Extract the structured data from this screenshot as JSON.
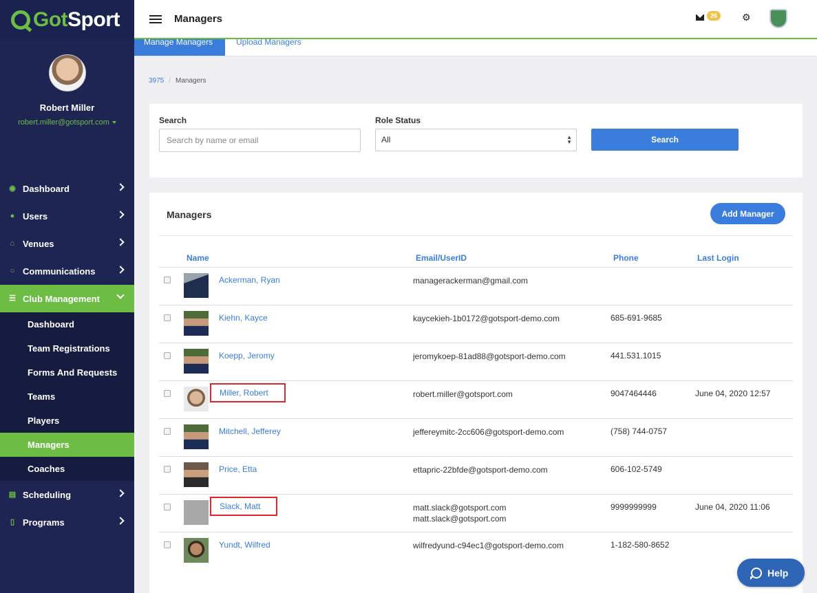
{
  "brand": {
    "logo_prefix": "Got",
    "logo_suffix": "Sport"
  },
  "profile": {
    "name": "Robert Miller",
    "email": "robert.miller@gotsport.com"
  },
  "sidebar": {
    "nav": [
      {
        "label": "Dashboard",
        "icon": "dashboard-icon"
      },
      {
        "label": "Users",
        "icon": "users-icon"
      },
      {
        "label": "Venues",
        "icon": "home-icon"
      },
      {
        "label": "Communications",
        "icon": "chat-icon"
      },
      {
        "label": "Club Management",
        "icon": "list-icon",
        "active": true
      }
    ],
    "sub": [
      "Dashboard",
      "Team Registrations",
      "Forms And Requests",
      "Teams",
      "Players",
      "Managers",
      "Coaches"
    ],
    "active_sub": "Managers",
    "nav_after": [
      {
        "label": "Scheduling",
        "icon": "calendar-icon"
      },
      {
        "label": "Programs",
        "icon": "document-icon"
      }
    ]
  },
  "topbar": {
    "title": "Managers",
    "badge_count": "26"
  },
  "tabs": {
    "manage": "Manage Managers",
    "upload": "Upload Managers"
  },
  "breadcrumb": {
    "link": "3975",
    "separator": "/",
    "current": "Managers"
  },
  "search": {
    "label": "Search",
    "placeholder": "Search by name or email",
    "role_label": "Role Status",
    "role_value": "All",
    "button": "Search"
  },
  "managers": {
    "title": "Managers",
    "add_button": "Add Manager",
    "columns": {
      "name": "Name",
      "email": "Email/UserID",
      "phone": "Phone",
      "last_login": "Last Login"
    },
    "rows": [
      {
        "name": "Ackerman, Ryan",
        "email": "managerackerman@gmail.com",
        "email2": "",
        "phone": "",
        "last_login": ""
      },
      {
        "name": "Kiehn, Kayce",
        "email": "kaycekieh-1b0172@gotsport-demo.com",
        "email2": "",
        "phone": "685-691-9685",
        "last_login": ""
      },
      {
        "name": "Koepp, Jeromy",
        "email": "jeromykoep-81ad88@gotsport-demo.com",
        "email2": "",
        "phone": "441.531.1015",
        "last_login": ""
      },
      {
        "name": "Miller, Robert",
        "email": "robert.miller@gotsport.com",
        "email2": "",
        "phone": "9047464446",
        "last_login": "June 04, 2020 12:57"
      },
      {
        "name": "Mitchell, Jefferey",
        "email": "jeffereymitc-2cc606@gotsport-demo.com",
        "email2": "",
        "phone": "(758) 744-0757",
        "last_login": ""
      },
      {
        "name": "Price, Etta",
        "email": "ettapric-22bfde@gotsport-demo.com",
        "email2": "",
        "phone": "606-102-5749",
        "last_login": ""
      },
      {
        "name": "Slack, Matt",
        "email": "matt.slack@gotsport.com",
        "email2": "matt.slack@gotsport.com",
        "phone": "9999999999",
        "last_login": "June 04, 2020 11:06"
      },
      {
        "name": "Yundt, Wilfred",
        "email": "wilfredyund-c94ec1@gotsport-demo.com",
        "email2": "",
        "phone": "1-182-580-8652",
        "last_login": ""
      }
    ]
  },
  "help": {
    "label": "Help"
  }
}
